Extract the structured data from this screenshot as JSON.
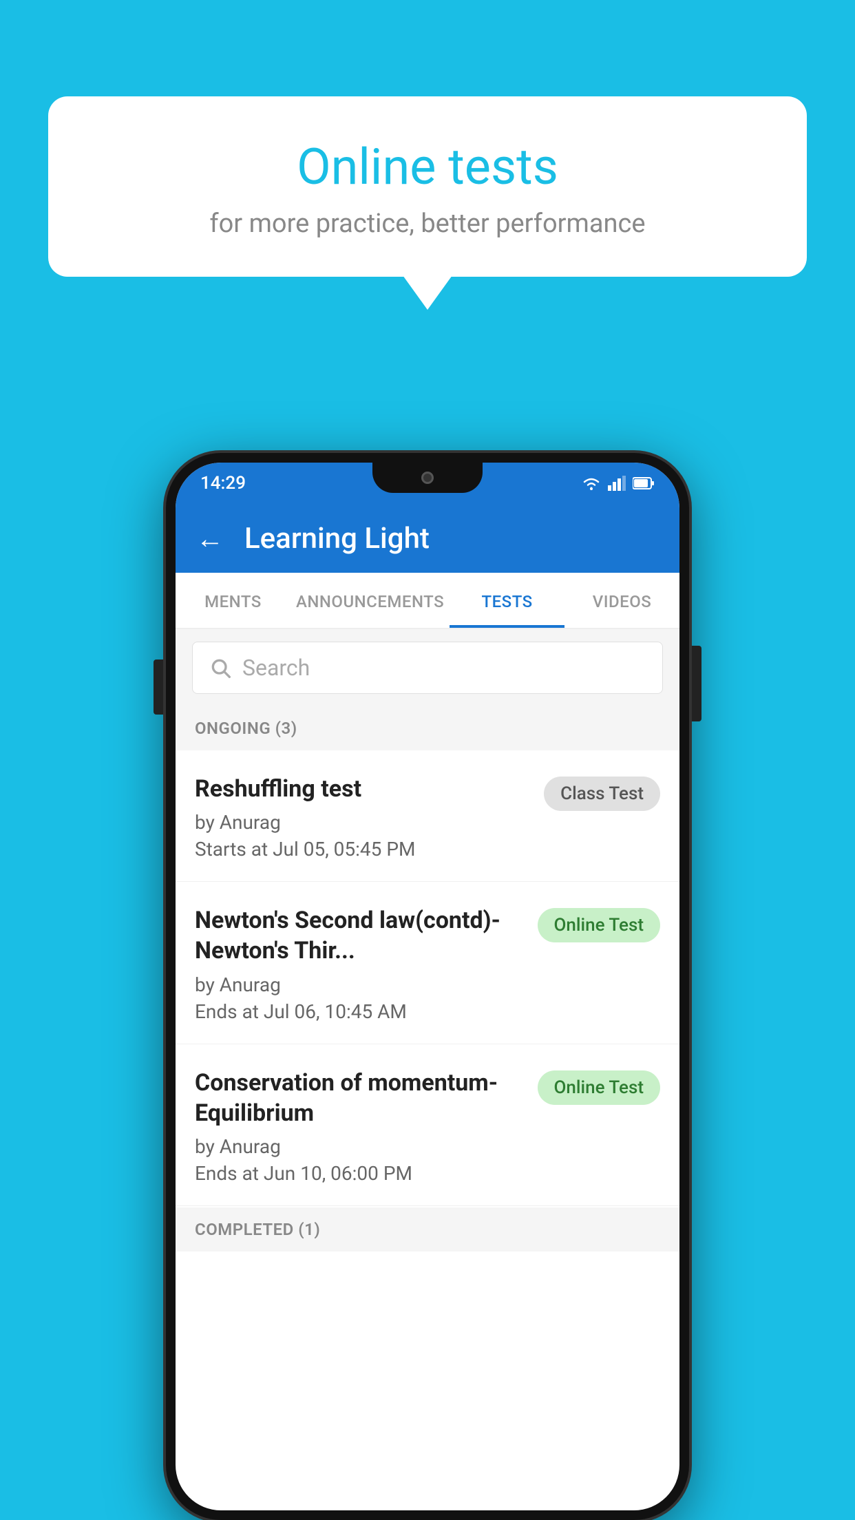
{
  "background_color": "#1ABEE5",
  "speech_bubble": {
    "title": "Online tests",
    "subtitle": "for more practice, better performance"
  },
  "status_bar": {
    "time": "14:29",
    "icons": [
      "wifi",
      "signal",
      "battery"
    ]
  },
  "app_bar": {
    "title": "Learning Light",
    "back_label": "←"
  },
  "tabs": [
    {
      "label": "MENTS",
      "active": false
    },
    {
      "label": "ANNOUNCEMENTS",
      "active": false
    },
    {
      "label": "TESTS",
      "active": true
    },
    {
      "label": "VIDEOS",
      "active": false
    }
  ],
  "search": {
    "placeholder": "Search"
  },
  "section_ongoing": {
    "label": "ONGOING (3)"
  },
  "tests": [
    {
      "name": "Reshuffling test",
      "author": "by Anurag",
      "time_label": "Starts at",
      "time_value": "Jul 05, 05:45 PM",
      "badge": "Class Test",
      "badge_type": "class"
    },
    {
      "name": "Newton's Second law(contd)-Newton's Thir...",
      "author": "by Anurag",
      "time_label": "Ends at",
      "time_value": "Jul 06, 10:45 AM",
      "badge": "Online Test",
      "badge_type": "online"
    },
    {
      "name": "Conservation of momentum-Equilibrium",
      "author": "by Anurag",
      "time_label": "Ends at",
      "time_value": "Jun 10, 06:00 PM",
      "badge": "Online Test",
      "badge_type": "online"
    }
  ],
  "section_completed": {
    "label": "COMPLETED (1)"
  }
}
